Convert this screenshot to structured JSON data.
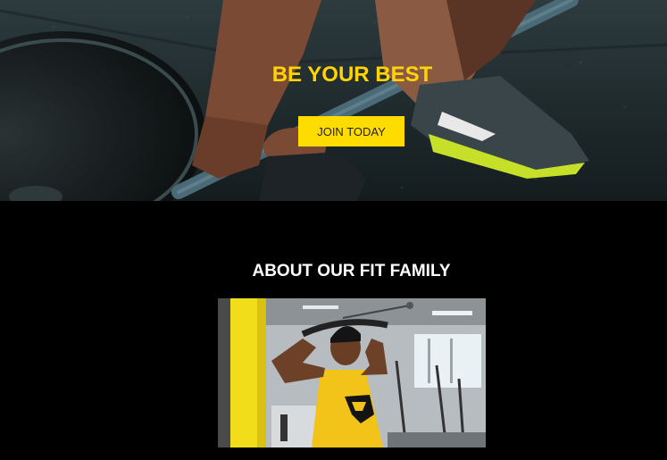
{
  "hero": {
    "headline": "BE YOUR BEST",
    "cta_label": "JOIN TODAY"
  },
  "about": {
    "heading": "ABOUT OUR FIT FAMILY"
  },
  "colors": {
    "accent_yellow": "#ffd400",
    "background": "#000000",
    "heading_white": "#ffffff"
  }
}
